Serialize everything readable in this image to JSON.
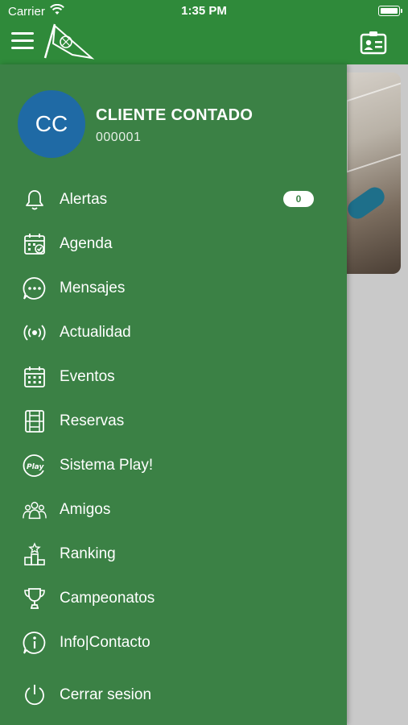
{
  "status_bar": {
    "carrier": "Carrier",
    "time": "1:35 PM"
  },
  "header": {
    "menu_icon": "hamburger-icon",
    "logo": "club-flag-logo",
    "right_icon": "id-card-icon"
  },
  "user": {
    "initials": "CC",
    "name": "CLIENTE CONTADO",
    "code": "000001"
  },
  "menu": {
    "items": [
      {
        "label": "Alertas",
        "icon": "bell-icon",
        "badge": "0"
      },
      {
        "label": "Agenda",
        "icon": "calendar-check-icon"
      },
      {
        "label": "Mensajes",
        "icon": "chat-icon"
      },
      {
        "label": "Actualidad",
        "icon": "broadcast-icon"
      },
      {
        "label": "Eventos",
        "icon": "calendar-grid-icon"
      },
      {
        "label": "Reservas",
        "icon": "court-icon"
      },
      {
        "label": "Sistema Play!",
        "icon": "play-icon"
      },
      {
        "label": "Amigos",
        "icon": "people-icon"
      },
      {
        "label": "Ranking",
        "icon": "podium-icon"
      },
      {
        "label": "Campeonatos",
        "icon": "trophy-icon"
      },
      {
        "label": "Info|Contacto",
        "icon": "info-icon"
      }
    ],
    "logout": {
      "label": "Cerrar sesion",
      "icon": "power-icon"
    }
  },
  "colors": {
    "header": "#2f8a3a",
    "drawer": "#3b8145",
    "avatar": "#1f6aa5",
    "badge_bg": "#ffffff"
  }
}
